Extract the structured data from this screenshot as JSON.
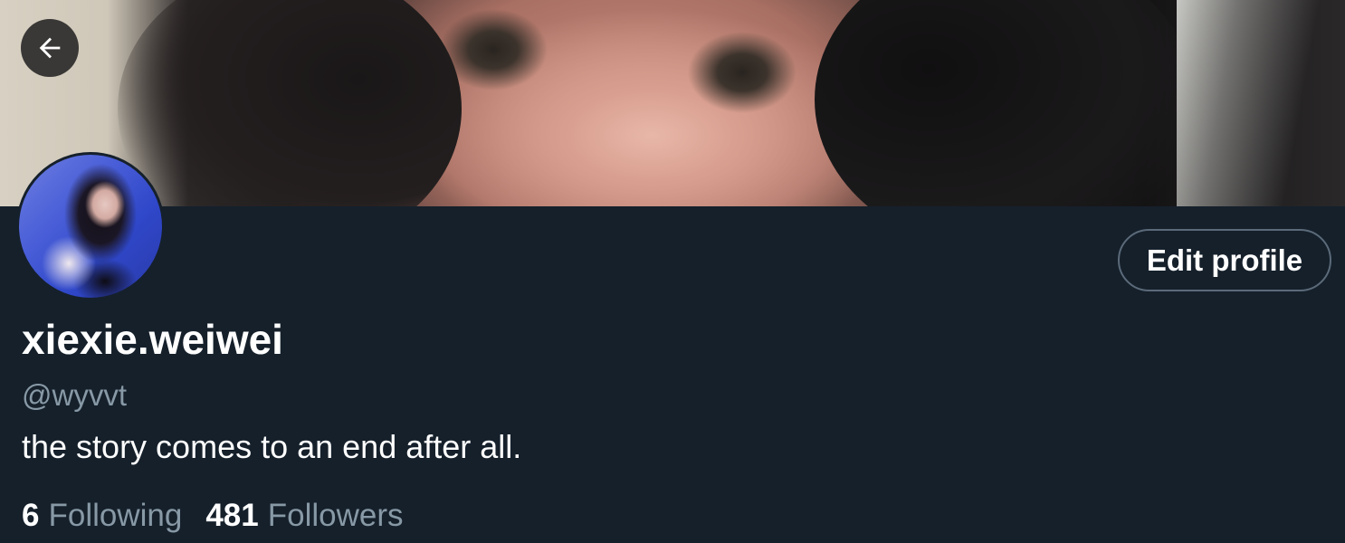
{
  "profile": {
    "display_name": "xiexie.weiwei",
    "handle": "@wyvvt",
    "bio": "the story comes to an end after all.",
    "edit_button_label": "Edit profile",
    "following_count": "6",
    "following_label": "Following",
    "followers_count": "481",
    "followers_label": "Followers"
  },
  "icons": {
    "back": "arrow-left-icon"
  },
  "colors": {
    "background": "#15202b",
    "primary_text": "#ffffff",
    "secondary_text": "#8899a6",
    "button_border": "#5b6a79"
  }
}
